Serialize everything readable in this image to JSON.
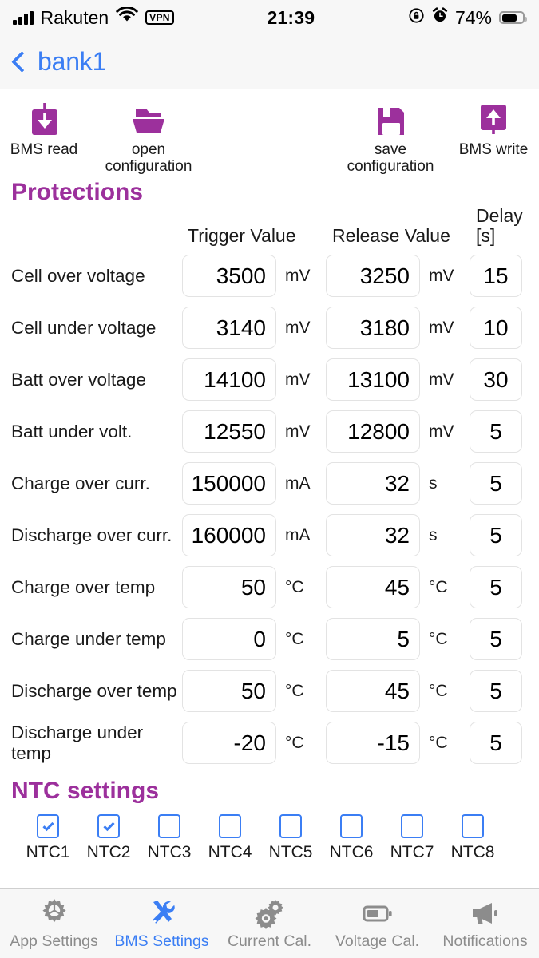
{
  "status_bar": {
    "carrier": "Rakuten",
    "vpn_badge": "VPN",
    "time": "21:39",
    "battery_percent": "74%",
    "battery_level": 74
  },
  "nav": {
    "back_label": "bank1"
  },
  "toolbar": {
    "items": [
      {
        "label": "BMS read",
        "icon": "download-square-icon"
      },
      {
        "label": "open\nconfiguration",
        "label_line1": "open",
        "label_line2": "configuration",
        "icon": "folder-icon"
      },
      {
        "label": "save\nconfiguration",
        "label_line1": "save",
        "label_line2": "configuration",
        "icon": "floppy-disk-icon"
      },
      {
        "label": "BMS write",
        "icon": "upload-square-icon"
      }
    ]
  },
  "protections": {
    "title": "Protections",
    "headers": {
      "trigger": "Trigger Value",
      "release": "Release Value",
      "delay_line1": "Delay",
      "delay_line2": "[s]"
    },
    "rows": [
      {
        "label": "Cell over voltage",
        "trigger": "3500",
        "trigger_unit": "mV",
        "release": "3250",
        "release_unit": "mV",
        "delay": "15"
      },
      {
        "label": "Cell under voltage",
        "trigger": "3140",
        "trigger_unit": "mV",
        "release": "3180",
        "release_unit": "mV",
        "delay": "10"
      },
      {
        "label": "Batt over voltage",
        "trigger": "14100",
        "trigger_unit": "mV",
        "release": "13100",
        "release_unit": "mV",
        "delay": "30"
      },
      {
        "label": "Batt under volt.",
        "trigger": "12550",
        "trigger_unit": "mV",
        "release": "12800",
        "release_unit": "mV",
        "delay": "5"
      },
      {
        "label": "Charge over curr.",
        "trigger": "150000",
        "trigger_unit": "mA",
        "release": "32",
        "release_unit": "s",
        "delay": "5"
      },
      {
        "label": "Discharge over curr.",
        "trigger": "160000",
        "trigger_unit": "mA",
        "release": "32",
        "release_unit": "s",
        "delay": "5"
      },
      {
        "label": "Charge over temp",
        "trigger": "50",
        "trigger_unit": "°C",
        "release": "45",
        "release_unit": "°C",
        "delay": "5"
      },
      {
        "label": "Charge under temp",
        "trigger": "0",
        "trigger_unit": "°C",
        "release": "5",
        "release_unit": "°C",
        "delay": "5"
      },
      {
        "label": "Discharge over temp",
        "trigger": "50",
        "trigger_unit": "°C",
        "release": "45",
        "release_unit": "°C",
        "delay": "5"
      },
      {
        "label": "Discharge under temp",
        "trigger": "-20",
        "trigger_unit": "°C",
        "release": "-15",
        "release_unit": "°C",
        "delay": "5"
      }
    ]
  },
  "ntc": {
    "title": "NTC settings",
    "items": [
      {
        "label": "NTC1",
        "checked": true
      },
      {
        "label": "NTC2",
        "checked": true
      },
      {
        "label": "NTC3",
        "checked": false
      },
      {
        "label": "NTC4",
        "checked": false
      },
      {
        "label": "NTC5",
        "checked": false
      },
      {
        "label": "NTC6",
        "checked": false
      },
      {
        "label": "NTC7",
        "checked": false
      },
      {
        "label": "NTC8",
        "checked": false
      }
    ]
  },
  "tabbar": {
    "active_index": 1,
    "tabs": [
      {
        "label": "App Settings",
        "icon": "gear-icon"
      },
      {
        "label": "BMS Settings",
        "icon": "tools-icon"
      },
      {
        "label": "Current Cal.",
        "icon": "gears-icon"
      },
      {
        "label": "Voltage Cal.",
        "icon": "battery-icon"
      },
      {
        "label": "Notifications",
        "icon": "megaphone-icon"
      }
    ]
  },
  "colors": {
    "accent_purple": "#9c309c",
    "accent_blue": "#3b7ef4",
    "bar_bg": "#f7f7f7",
    "inactive_gray": "#8c8c8c"
  }
}
